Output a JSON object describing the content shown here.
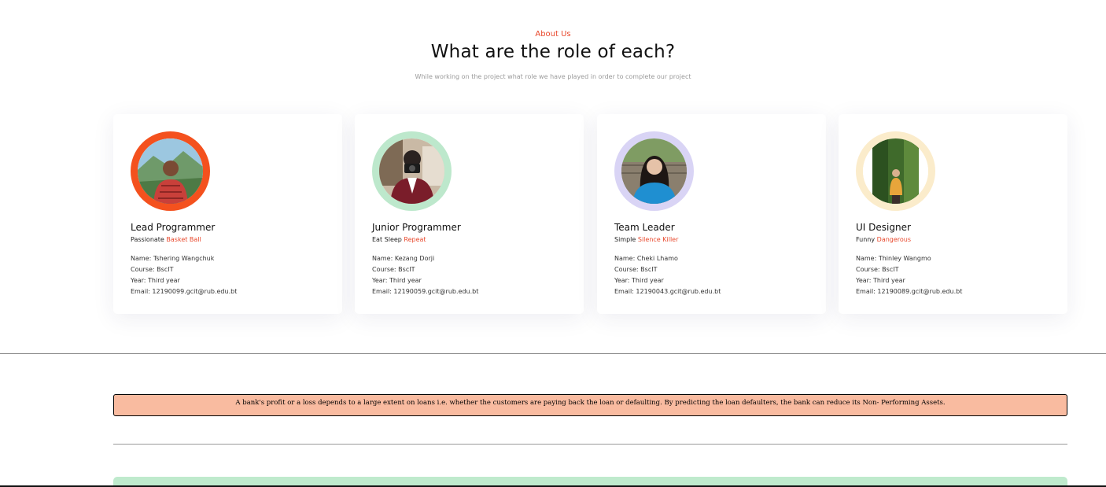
{
  "header": {
    "eyebrow": "About Us",
    "title": "What are the role of each?",
    "subtitle": "While working on the project what role we have played in order to complete our project"
  },
  "members": [
    {
      "role": "Lead Programmer",
      "tag_plain": "Passionate",
      "tag_accent": "Basket Ball",
      "name": "Name: Tshering Wangchuk",
      "course": "Course: BscIT",
      "year": "Year: Third year",
      "email": "Email: 12190099.gcit@rub.edu.bt",
      "ring_color": "#f4511e"
    },
    {
      "role": "Junior Programmer",
      "tag_plain": "Eat Sleep",
      "tag_accent": "Repeat",
      "name": "Name: Kezang Dorji",
      "course": "Course: BscIT",
      "year": "Year: Third year",
      "email": "Email: 12190059.gcit@rub.edu.bt",
      "ring_color": "#bde8cc"
    },
    {
      "role": "Team Leader",
      "tag_plain": "Simple",
      "tag_accent": "Silence Killer",
      "name": "Name: Cheki Lhamo",
      "course": "Course: BscIT",
      "year": "Year: Third year",
      "email": "Email: 12190043.gcit@rub.edu.bt",
      "ring_color": "#d9d4f5"
    },
    {
      "role": "UI Designer",
      "tag_plain": "Funny",
      "tag_accent": "Dangerous",
      "name": "Name: Thinley Wangmo",
      "course": "Course: BscIT",
      "year": "Year: Third year",
      "email": "Email: 12190089.gcit@rub.edu.bt",
      "ring_color": "#fbeccb"
    }
  ],
  "notice": {
    "text": "A bank's profit or a loss depends to a large extent on loans i.e. whether the customers are paying back the loan or defaulting. By predicting the loan defaulters, the bank can reduce its Non- Performing Assets."
  },
  "colors": {
    "accent": "#e8472b",
    "notice_bg": "#f9bba0",
    "green_card": "#bfeacd"
  }
}
